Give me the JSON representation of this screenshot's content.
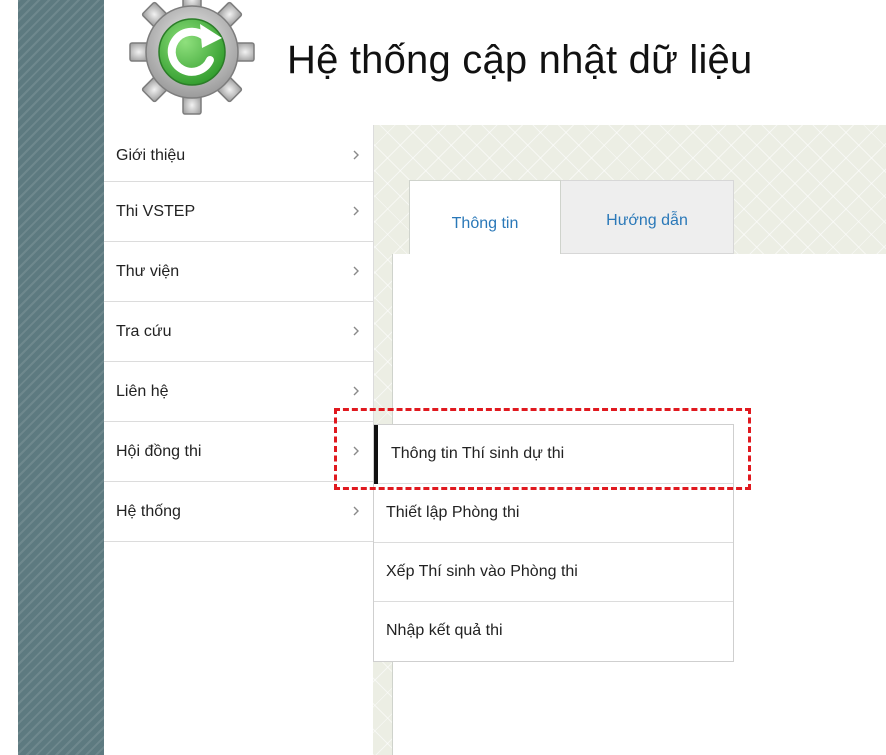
{
  "app": {
    "title": "Hệ thống cập nhật dữ liệu",
    "logo_icon": "gear-refresh-icon"
  },
  "nav": {
    "items": [
      {
        "label": "Giới thiệu"
      },
      {
        "label": "Thi VSTEP"
      },
      {
        "label": "Thư viện"
      },
      {
        "label": "Tra cứu"
      },
      {
        "label": "Liên hệ"
      },
      {
        "label": "Hội đồng thi"
      },
      {
        "label": "Hệ thống"
      }
    ],
    "chevron_icon": "chevron-right-icon"
  },
  "submenu": {
    "parent": "Hội đồng thi",
    "items": [
      {
        "label": "Thông tin Thí sinh dự thi",
        "active": true
      },
      {
        "label": "Thiết lập Phòng thi"
      },
      {
        "label": "Xếp Thí sinh vào Phòng thi"
      },
      {
        "label": "Nhập kết quả thi"
      }
    ]
  },
  "tabs": [
    {
      "label": "Thông tin",
      "active": true
    },
    {
      "label": "Hướng dẫn"
    }
  ],
  "colors": {
    "link": "#2a78b8",
    "highlight": "#e0191f",
    "stripe": "#5d7a80",
    "logo_green": "#3fae3a"
  }
}
